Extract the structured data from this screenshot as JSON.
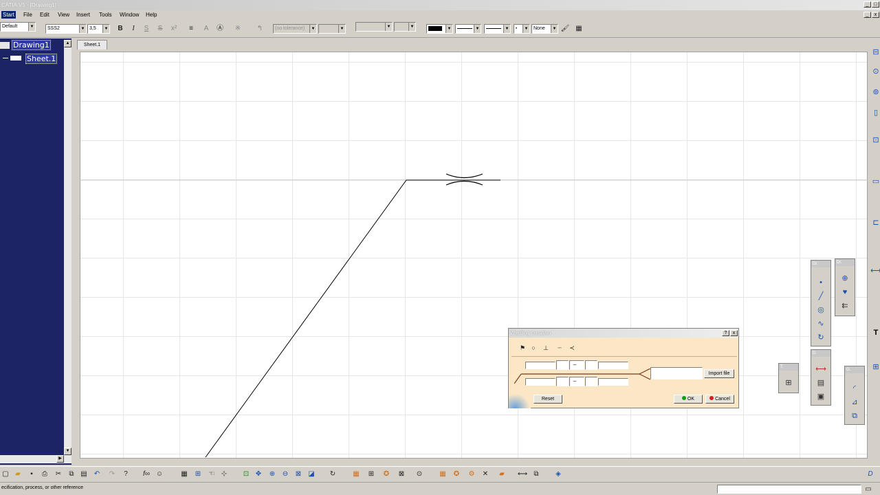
{
  "window": {
    "title": "CATIA V5 - [Drawing1]"
  },
  "menu": [
    {
      "label": "Start"
    },
    {
      "label": "File"
    },
    {
      "label": "Edit"
    },
    {
      "label": "View"
    },
    {
      "label": "Insert"
    },
    {
      "label": "Tools"
    },
    {
      "label": "Window"
    },
    {
      "label": "Help"
    }
  ],
  "toolbar": {
    "style": "Default",
    "font": "SSS2",
    "font_size": "3,5",
    "tolerance": "(no tolerance)",
    "line_none": "None",
    "buttons": {
      "bold": "B",
      "italic": "I",
      "underline": "S",
      "strike": "S"
    }
  },
  "tree": [
    {
      "label": "Drawing1"
    },
    {
      "label": "Sheet.1"
    }
  ],
  "sheet_tab": "Sheet.1",
  "welding_dialog": {
    "title": "Welding creation",
    "help_label": "?",
    "close_label": "x",
    "import_label": "Import file",
    "reset_label": "Reset",
    "ok_label": "OK",
    "cancel_label": "Cancel"
  },
  "palettes": {
    "p1": "Dr.",
    "p2": "Dr.",
    "p3": "T.",
    "p4": "D.",
    "p5": "G."
  },
  "status": {
    "text": "ecification, process, or other reference"
  },
  "colors": {
    "tree_bg": "#1d2466",
    "dialog_bg": "#fbe7c6",
    "weld_line": "#7a3a1a"
  }
}
